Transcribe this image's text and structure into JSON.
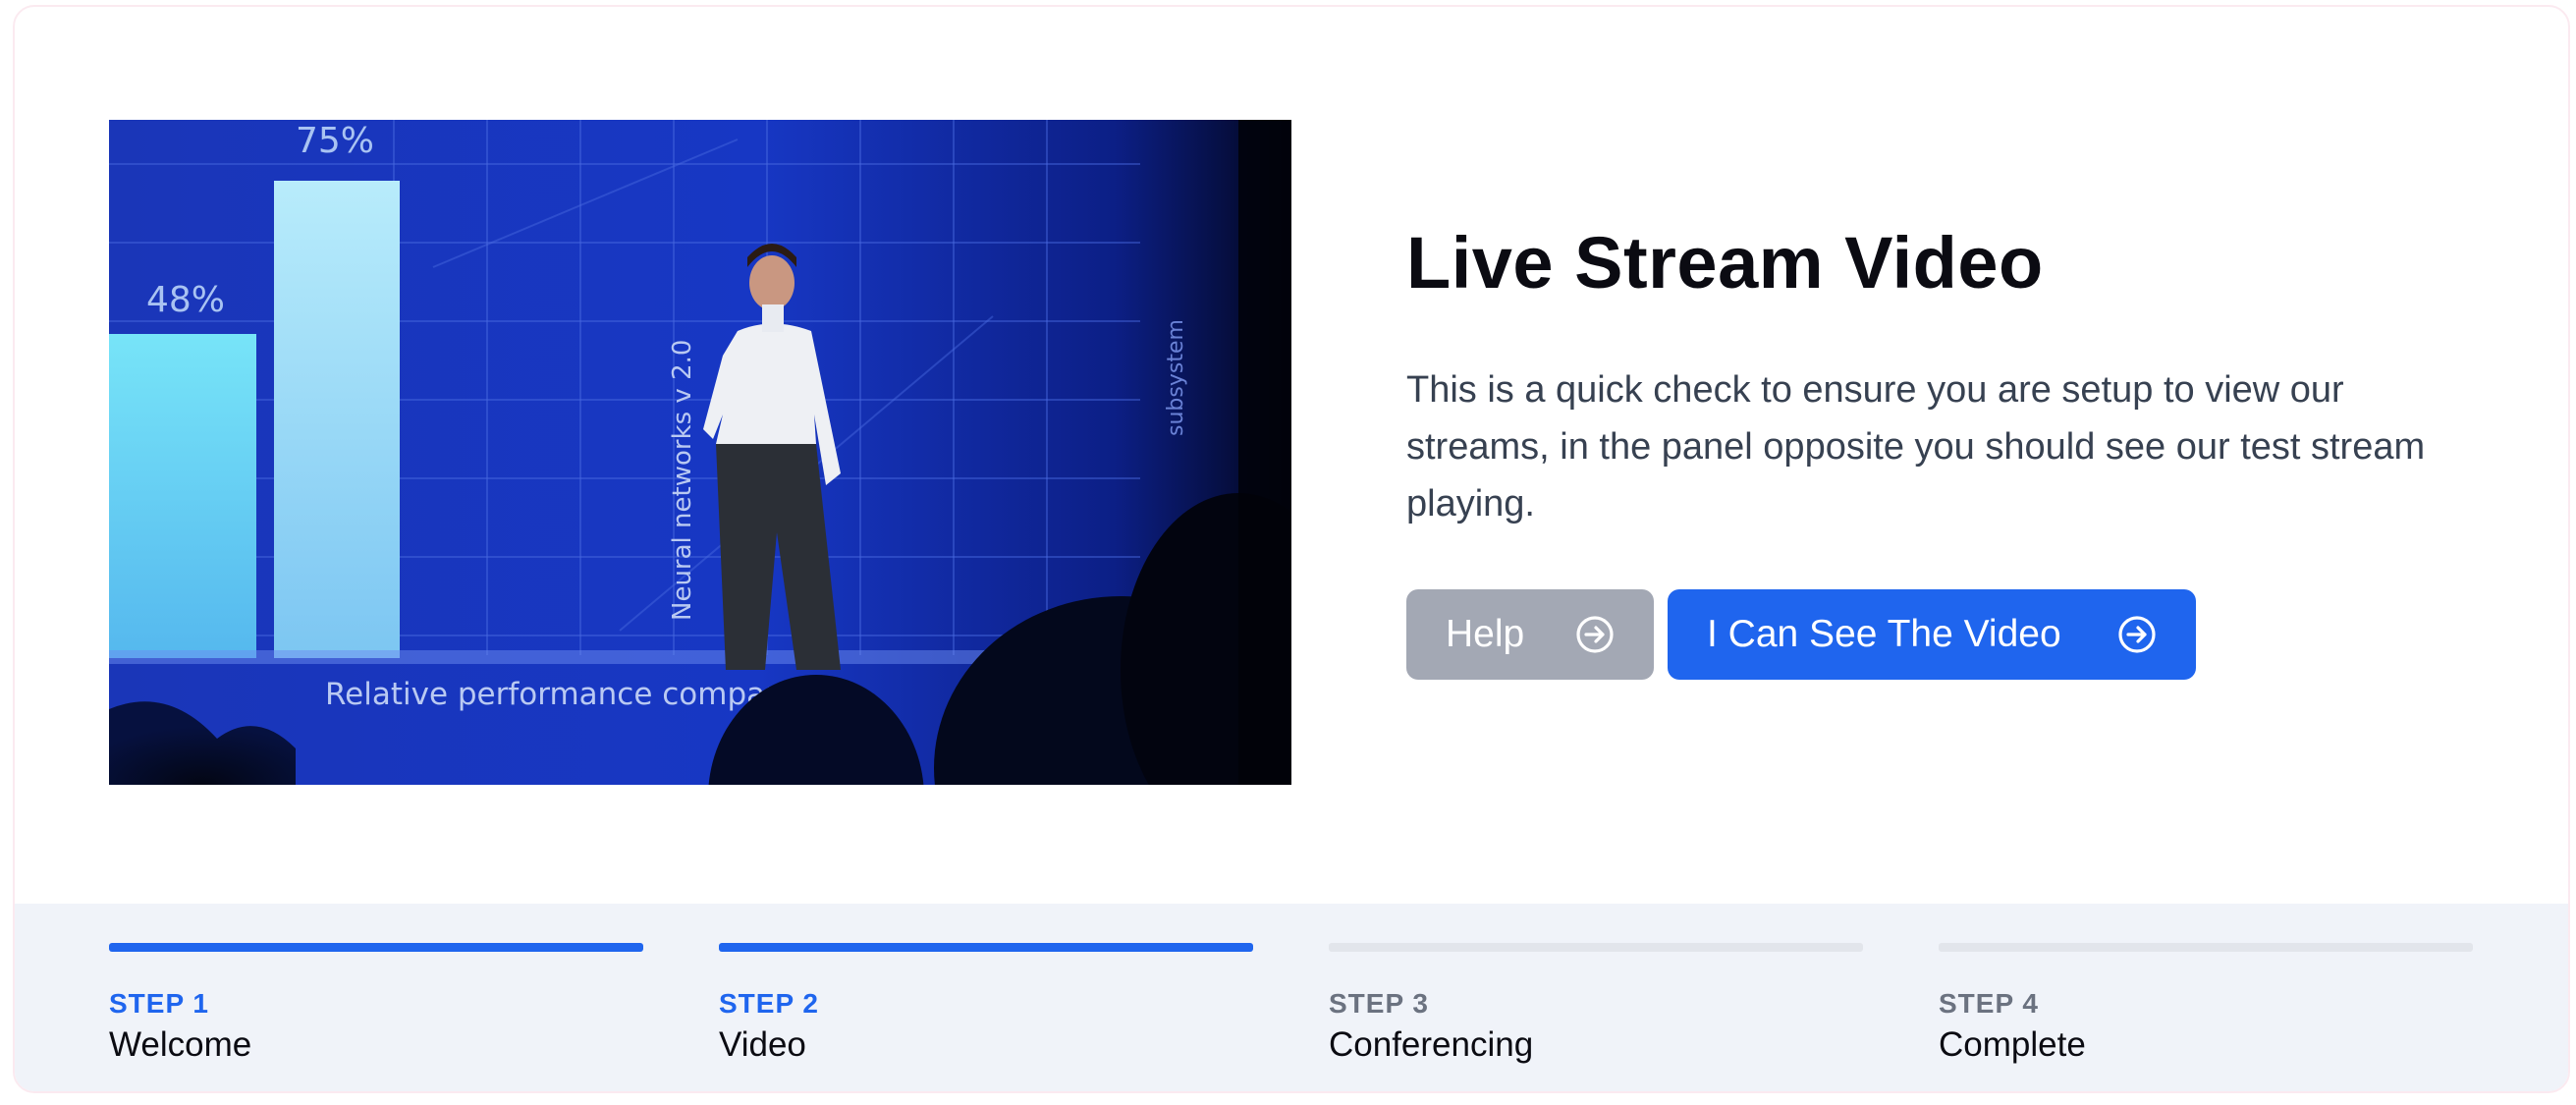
{
  "panel": {
    "title": "Live Stream Video",
    "description": "This is a quick check to ensure you are setup to view our streams, in the panel opposite you should see our test stream playing.",
    "help_label": "Help",
    "confirm_label": "I Can See The Video"
  },
  "video": {
    "bar_labels": [
      "48%",
      "75%"
    ],
    "axis_caption": "Relative performance compar",
    "vertical_text_1": "Neural networks v 2.0",
    "vertical_text_2": "subsystem"
  },
  "steps": [
    {
      "number": "STEP 1",
      "name": "Welcome",
      "state": "complete"
    },
    {
      "number": "STEP 2",
      "name": "Video",
      "state": "current"
    },
    {
      "number": "STEP 3",
      "name": "Conferencing",
      "state": "upcoming"
    },
    {
      "number": "STEP 4",
      "name": "Complete",
      "state": "upcoming"
    }
  ],
  "colors": {
    "accent": "#1f65ee",
    "inactive_bar": "#e2e5eb",
    "inactive_text": "#6b7280",
    "help_button": "#a3a8b4",
    "footer_bg": "#f0f3f9"
  },
  "icons": {
    "button_arrow": "arrow-right-circle-icon"
  }
}
